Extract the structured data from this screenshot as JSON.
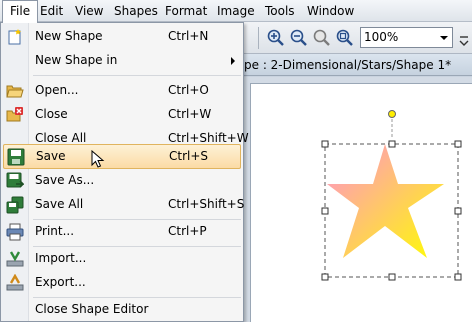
{
  "menubar": {
    "items": [
      {
        "label": "File",
        "open": true
      },
      {
        "label": "Edit"
      },
      {
        "label": "View"
      },
      {
        "label": "Shapes"
      },
      {
        "label": "Format"
      },
      {
        "label": "Image"
      },
      {
        "label": "Tools"
      },
      {
        "label": "Window"
      }
    ]
  },
  "toolbar": {
    "zoom_value": "100%",
    "icons": [
      "zoom-in-icon",
      "zoom-out-icon",
      "zoom-actual-icon",
      "zoom-fit-icon"
    ]
  },
  "editor": {
    "title": "pe : 2-Dimensional/Stars/Shape 1*"
  },
  "file_menu": {
    "items": [
      {
        "label": "New Shape",
        "shortcut": "Ctrl+N",
        "icon": "new-shape-icon"
      },
      {
        "label": "New Shape in",
        "shortcut": "",
        "submenu": true
      },
      {
        "label": "Open...",
        "shortcut": "Ctrl+O",
        "icon": "open-folder-icon"
      },
      {
        "label": "Close",
        "shortcut": "Ctrl+W",
        "icon": "close-document-icon"
      },
      {
        "label": "Close All",
        "shortcut": "Ctrl+Shift+W"
      },
      {
        "label": "Save",
        "shortcut": "Ctrl+S",
        "icon": "save-icon",
        "highlighted": true
      },
      {
        "label": "Save As...",
        "shortcut": "",
        "icon": "save-as-icon"
      },
      {
        "label": "Save All",
        "shortcut": "Ctrl+Shift+S",
        "icon": "save-all-icon"
      },
      {
        "label": "Print...",
        "shortcut": "Ctrl+P",
        "icon": "print-icon"
      },
      {
        "label": "Import...",
        "shortcut": "",
        "icon": "import-icon"
      },
      {
        "label": "Export...",
        "shortcut": "",
        "icon": "export-icon"
      },
      {
        "label": "Close Shape Editor",
        "shortcut": ""
      }
    ]
  },
  "shape": {
    "fill_start": "#ff8fd0",
    "fill_end": "#ffff00",
    "rotation_handle_color": "#ffee00"
  },
  "colors": {
    "highlight_bg": "#fbdba5",
    "highlight_border": "#e0b45e",
    "menu_bg": "#f5f5f5"
  }
}
